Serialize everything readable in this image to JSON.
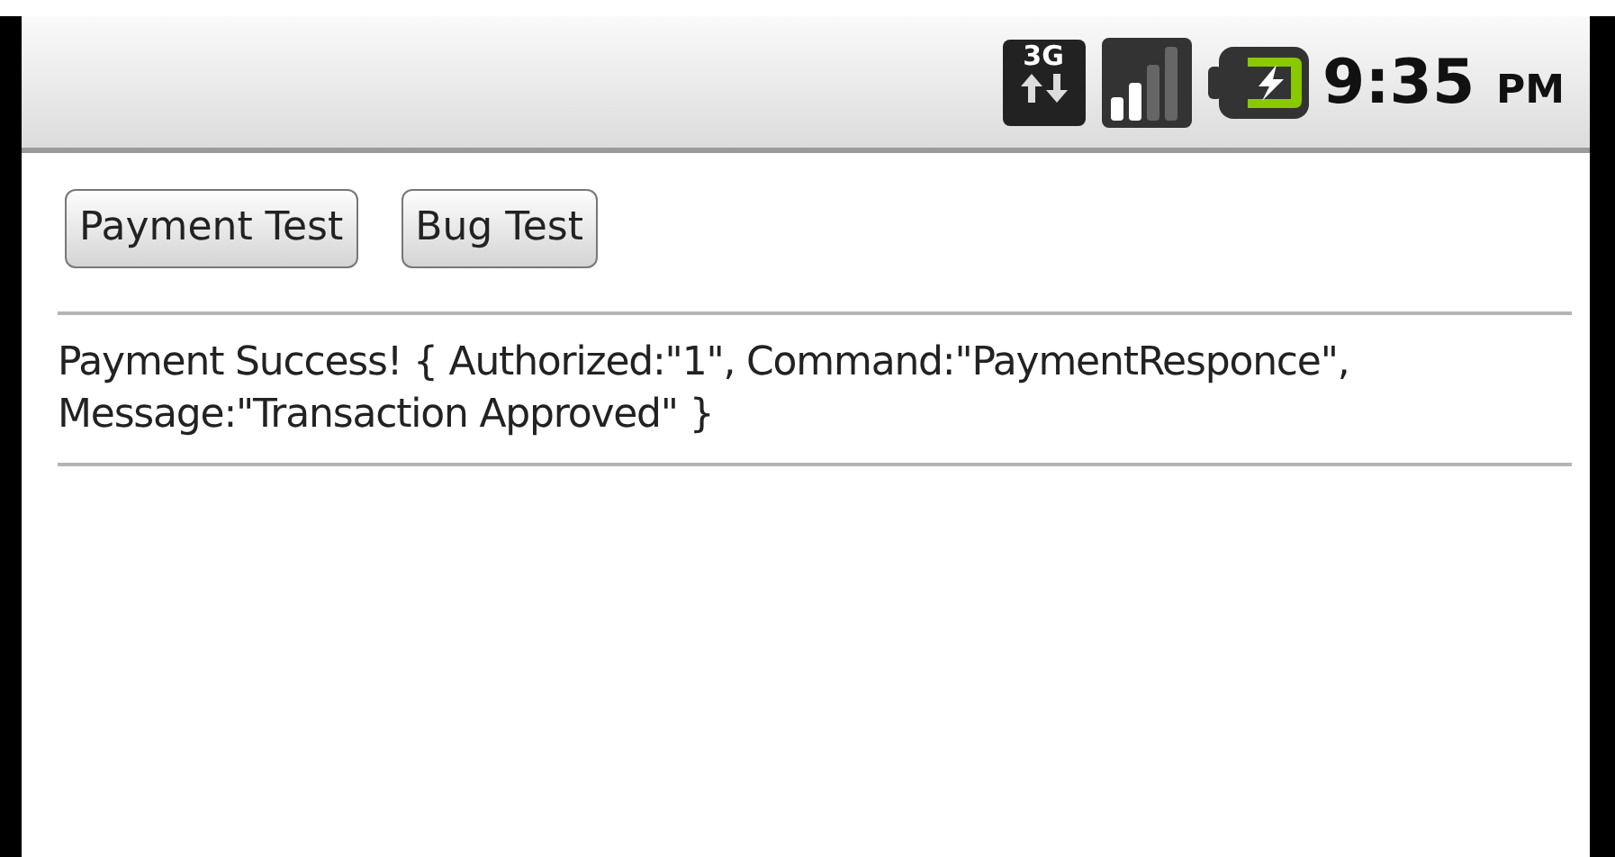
{
  "status_bar": {
    "network_type": "3G",
    "time": "9:35",
    "meridiem": "PM"
  },
  "buttons": [
    {
      "label": "Payment Test"
    },
    {
      "label": "Bug Test"
    }
  ],
  "result_text": "Payment Success! { Authorized:\"1\", Command:\"PaymentResponce\", Message:\"Transaction Approved\" }"
}
